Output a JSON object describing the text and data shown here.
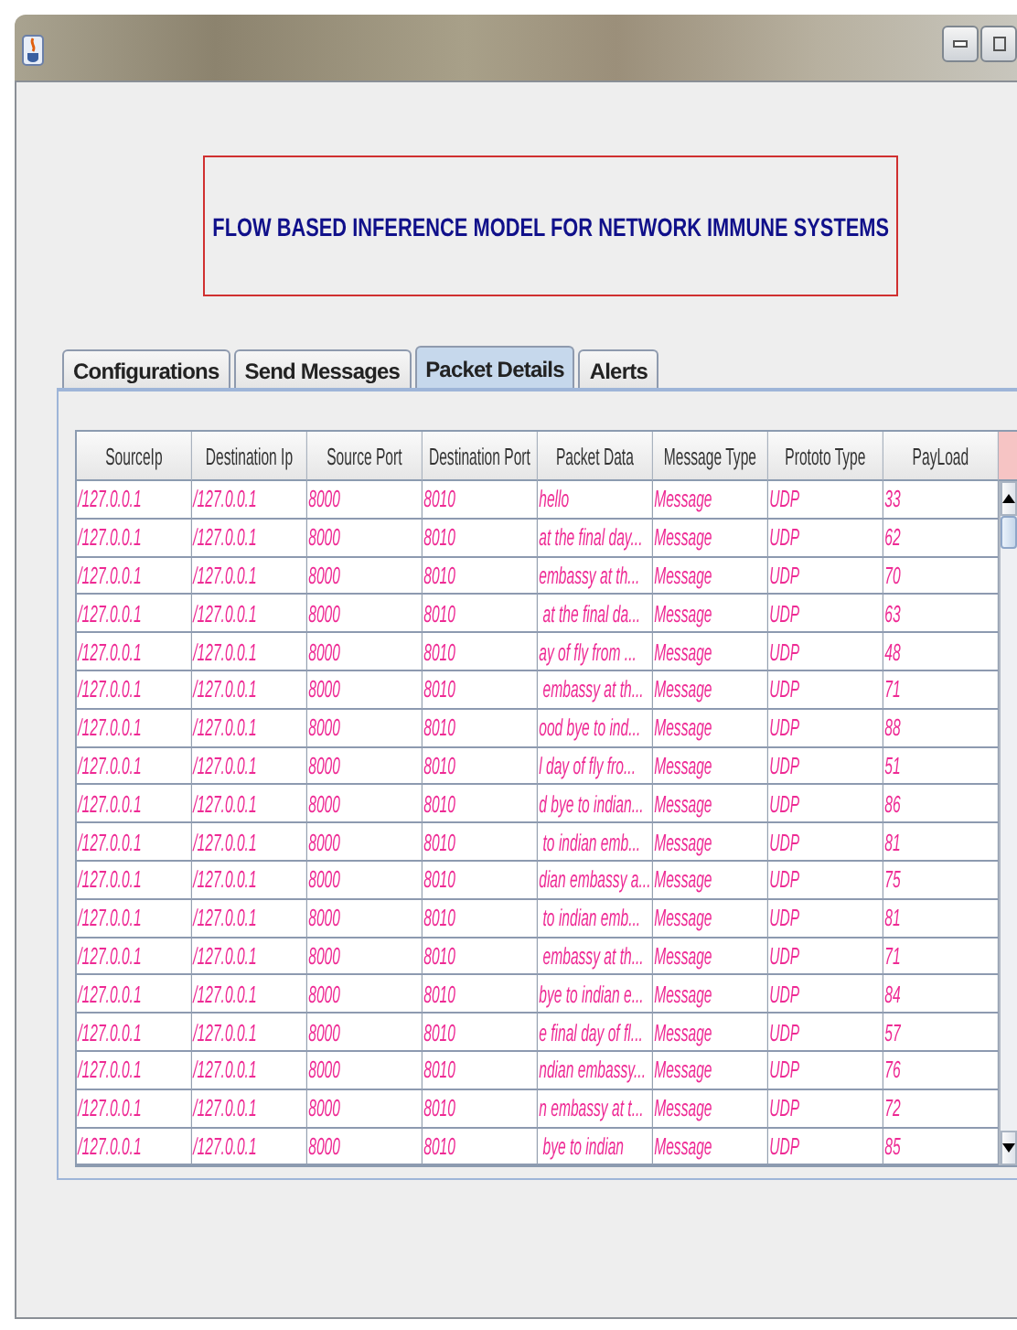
{
  "heading": "FLOW BASED INFERENCE MODEL FOR NETWORK IMMUNE SYSTEMS",
  "tabs": [
    {
      "label": "Configurations",
      "selected": false
    },
    {
      "label": "Send Messages",
      "selected": false
    },
    {
      "label": "Packet Details",
      "selected": true
    },
    {
      "label": "Alerts",
      "selected": false
    }
  ],
  "table": {
    "columns": [
      "SourceIp",
      "Destination Ip",
      "Source Port",
      "Destination Port",
      "Packet Data",
      "Message Type",
      "Prototo Type",
      "PayLoad"
    ],
    "rows": [
      [
        "/127.0.0.1",
        "/127.0.0.1",
        "8000",
        "8010",
        "hello",
        "Message",
        "UDP",
        "33"
      ],
      [
        "/127.0.0.1",
        "/127.0.0.1",
        "8000",
        "8010",
        "at the final day...",
        "Message",
        "UDP",
        "62"
      ],
      [
        "/127.0.0.1",
        "/127.0.0.1",
        "8000",
        "8010",
        "embassy at th...",
        "Message",
        "UDP",
        "70"
      ],
      [
        "/127.0.0.1",
        "/127.0.0.1",
        "8000",
        "8010",
        " at the final da...",
        "Message",
        "UDP",
        "63"
      ],
      [
        "/127.0.0.1",
        "/127.0.0.1",
        "8000",
        "8010",
        "ay of fly from ...",
        "Message",
        "UDP",
        "48"
      ],
      [
        "/127.0.0.1",
        "/127.0.0.1",
        "8000",
        "8010",
        " embassy at th...",
        "Message",
        "UDP",
        "71"
      ],
      [
        "/127.0.0.1",
        "/127.0.0.1",
        "8000",
        "8010",
        "ood bye to ind...",
        "Message",
        "UDP",
        "88"
      ],
      [
        "/127.0.0.1",
        "/127.0.0.1",
        "8000",
        "8010",
        "l day of fly fro...",
        "Message",
        "UDP",
        "51"
      ],
      [
        "/127.0.0.1",
        "/127.0.0.1",
        "8000",
        "8010",
        "d bye to indian...",
        "Message",
        "UDP",
        "86"
      ],
      [
        "/127.0.0.1",
        "/127.0.0.1",
        "8000",
        "8010",
        " to indian emb...",
        "Message",
        "UDP",
        "81"
      ],
      [
        "/127.0.0.1",
        "/127.0.0.1",
        "8000",
        "8010",
        "dian embassy a...",
        "Message",
        "UDP",
        "75"
      ],
      [
        "/127.0.0.1",
        "/127.0.0.1",
        "8000",
        "8010",
        " to indian emb...",
        "Message",
        "UDP",
        "81"
      ],
      [
        "/127.0.0.1",
        "/127.0.0.1",
        "8000",
        "8010",
        " embassy at th...",
        "Message",
        "UDP",
        "71"
      ],
      [
        "/127.0.0.1",
        "/127.0.0.1",
        "8000",
        "8010",
        "bye to indian e...",
        "Message",
        "UDP",
        "84"
      ],
      [
        "/127.0.0.1",
        "/127.0.0.1",
        "8000",
        "8010",
        "e final day of fl...",
        "Message",
        "UDP",
        "57"
      ],
      [
        "/127.0.0.1",
        "/127.0.0.1",
        "8000",
        "8010",
        "ndian embassy...",
        "Message",
        "UDP",
        "76"
      ],
      [
        "/127.0.0.1",
        "/127.0.0.1",
        "8000",
        "8010",
        "n embassy at t...",
        "Message",
        "UDP",
        "72"
      ],
      [
        "/127.0.0.1",
        "/127.0.0.1",
        "8000",
        "8010",
        " bye to indian",
        "Message",
        "UDP",
        "85"
      ]
    ]
  }
}
